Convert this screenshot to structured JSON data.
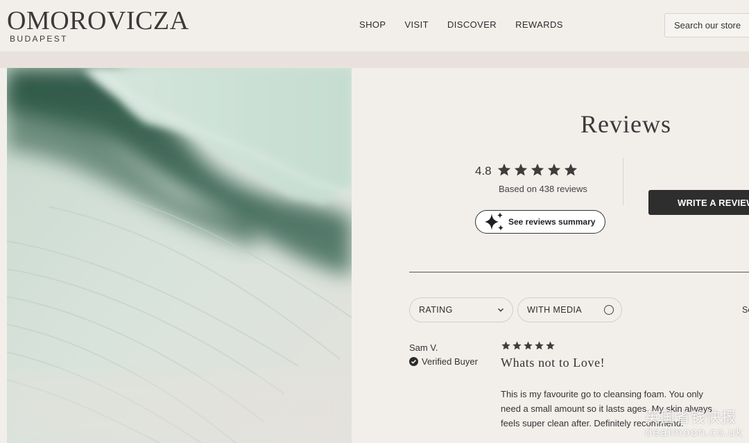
{
  "brand": {
    "name": "OMOROVICZA",
    "sub": "BUDAPEST"
  },
  "nav": [
    {
      "label": "SHOP"
    },
    {
      "label": "VISIT"
    },
    {
      "label": "DISCOVER"
    },
    {
      "label": "REWARDS"
    }
  ],
  "search": {
    "placeholder": "Search our store"
  },
  "product_image": {
    "description_icon": "cleansing-foam-texture"
  },
  "reviews": {
    "title": "Reviews",
    "average": "4.8",
    "star_count": 5,
    "based_on": "Based on 438 reviews",
    "summary_button": "See reviews summary",
    "write_button": "WRITE A REVIEW",
    "filters": {
      "rating": "RATING",
      "media": "WITH MEDIA",
      "sort": "So"
    }
  },
  "review": {
    "author": "Sam V.",
    "badge": "Verified Buyer",
    "rating": 5,
    "title": "Whats not to Love!",
    "body_lines": [
      "This is my favourite go to cleansing foam. You only",
      "need a small amount so it lasts ages. My skin always",
      "feels super clean after. Definitely recommend."
    ]
  },
  "watermark": {
    "line1": "英国省钱快报",
    "line2": "dealmoon.co.uk"
  },
  "colors": {
    "accent_dark": "#2e2e2e",
    "background": "#f2efeb",
    "band": "#e9e2dc",
    "star": "#3d3d3d"
  }
}
